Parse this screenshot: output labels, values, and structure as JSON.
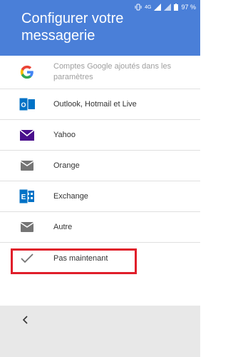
{
  "status": {
    "network": "4G",
    "battery": "97 %"
  },
  "header": {
    "title": "Configurer votre messagerie"
  },
  "accounts": [
    {
      "label": "Comptes Google ajoutés dans les paramètres",
      "icon": "google-icon",
      "muted": true
    },
    {
      "label": "Outlook, Hotmail et Live",
      "icon": "outlook-icon"
    },
    {
      "label": "Yahoo",
      "icon": "yahoo-mail-icon"
    },
    {
      "label": "Orange",
      "icon": "mail-icon"
    },
    {
      "label": "Exchange",
      "icon": "exchange-icon"
    },
    {
      "label": "Autre",
      "icon": "mail-icon"
    },
    {
      "label": "Pas maintenant",
      "icon": "check-icon"
    }
  ],
  "colors": {
    "header": "#4a7fd8",
    "highlight": "#e01e2a",
    "yahoo": "#4a0f8c",
    "outlook": "#0072c6"
  },
  "footer": {
    "back_icon": "chevron-left-icon"
  }
}
